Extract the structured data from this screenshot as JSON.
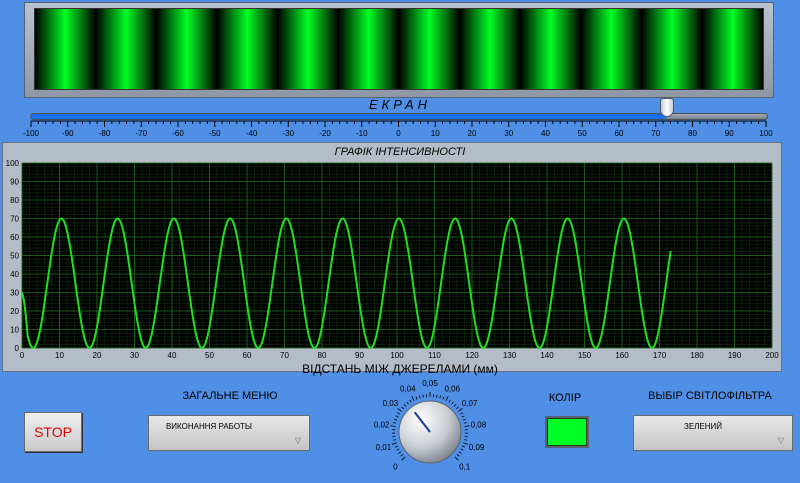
{
  "screen": {
    "label": "ЕКРАН",
    "fringe_count": 12
  },
  "slider": {
    "value": 73,
    "min": -100,
    "max": 100,
    "ticks": [
      "-100",
      "-90",
      "-80",
      "-70",
      "-60",
      "-50",
      "-40",
      "-30",
      "-20",
      "-10",
      "0",
      "10",
      "20",
      "30",
      "40",
      "50",
      "60",
      "70",
      "80",
      "90",
      "100"
    ]
  },
  "chart_data": {
    "type": "line",
    "title": "ГРАФІК ІНТЕНСИВНОСТІ",
    "xlabel": "ВІДСТАНЬ МІЖ ДЖЕРЕЛАМИ (мм)",
    "ylabel": "",
    "xlim": [
      0,
      200
    ],
    "ylim": [
      0,
      100
    ],
    "x_ticks": [
      "0",
      "10",
      "20",
      "30",
      "40",
      "50",
      "60",
      "70",
      "80",
      "90",
      "100",
      "110",
      "120",
      "130",
      "140",
      "150",
      "160",
      "170",
      "180",
      "190",
      "200"
    ],
    "y_ticks": [
      "0",
      "10",
      "20",
      "30",
      "40",
      "50",
      "60",
      "70",
      "80",
      "90",
      "100"
    ],
    "grid": true,
    "series": [
      {
        "period": 15,
        "amplitude": 70,
        "first_peak_x": 10.5,
        "start_x": 0,
        "start_y": 30,
        "end_x": 173,
        "end_y": 54
      }
    ],
    "colors": {
      "line": "#22dd22",
      "background": "#000000",
      "grid": "#1f6b1f"
    }
  },
  "controls": {
    "stop_label": "STOP",
    "general_menu": {
      "label": "ЗАГАЛЬНЕ МЕНЮ",
      "value": "ВИКОНАННЯ РАБОТЫ"
    },
    "knob": {
      "ticks": [
        "0",
        "0,01",
        "0,02",
        "0,03",
        "0,04",
        "0,05",
        "0,06",
        "0,07",
        "0,08",
        "0,09",
        "0,1"
      ],
      "value": 0.036
    },
    "color": {
      "label": "КОЛІР",
      "value": "#00ff24"
    },
    "filter": {
      "label": "ВЫБІР СВІТЛОФІЛЬТРА",
      "value": "ЗЕЛЕНИЙ"
    }
  },
  "colors": {
    "background": "#4f8fe6",
    "accent": "#1a6ff0",
    "fringe": "#00ff24"
  }
}
